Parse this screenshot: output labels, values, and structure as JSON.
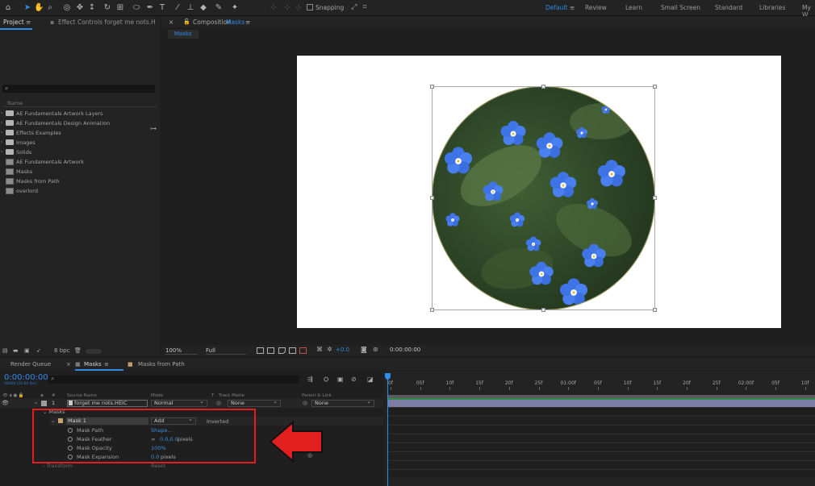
{
  "toolbar": {
    "tools": [
      "selection-tool",
      "hand-tool",
      "zoom-tool",
      "orbit-tool",
      "pan-tool",
      "dolly-tool",
      "rotate-tool",
      "anchor-tool",
      "ellipse-tool",
      "pen-tool",
      "type-tool",
      "brush-tool",
      "clone-tool",
      "eraser-tool",
      "roto-tool",
      "puppet-tool"
    ],
    "snapping_label": "Snapping",
    "workspaces": [
      "Default",
      "Review",
      "Learn",
      "Small Screen",
      "Standard",
      "Libraries",
      "My W"
    ],
    "active_workspace": "Default"
  },
  "project_panel": {
    "tab_project": "Project",
    "tab_effect_controls": "Effect Controls forget me nots.H",
    "column_name": "Name",
    "items": [
      {
        "label": "AE Fundamentals Artwork Layers",
        "type": "folder"
      },
      {
        "label": "AE Fundamentals Design Animation",
        "type": "folder"
      },
      {
        "label": "Effects Examples",
        "type": "folder"
      },
      {
        "label": "Images",
        "type": "folder"
      },
      {
        "label": "Solids",
        "type": "folder"
      },
      {
        "label": "AE Fundamentals Artwork",
        "type": "comp"
      },
      {
        "label": "Masks",
        "type": "comp"
      },
      {
        "label": "Masks from Path",
        "type": "comp"
      },
      {
        "label": "overlord",
        "type": "comp"
      }
    ],
    "bpc": "8 bpc"
  },
  "composition_panel": {
    "title_prefix": "Composition",
    "title_name": "Masks",
    "sub_tab": "Masks",
    "zoom": "100%",
    "resolution": "Full",
    "exposure": "+0.0",
    "timecode": "0:00:00:00"
  },
  "timeline": {
    "tabs": {
      "render_queue": "Render Queue",
      "masks": "Masks",
      "masks_from_path": "Masks from Path"
    },
    "current_time": "0:00:00:00",
    "current_time_sub": "00000 (30.00 fps)",
    "columns": {
      "num": "#",
      "source_name": "Source Name",
      "mode": "Mode",
      "t": "T",
      "track_matte": "Track Matte",
      "parent": "Parent & Link"
    },
    "layer": {
      "number": "1",
      "name": "forget me nots.HEIC",
      "mode": "Normal",
      "track_matte": "None",
      "parent": "None"
    },
    "masks_group": "Masks",
    "mask": {
      "name": "Mask 1",
      "mode": "Add",
      "inverted_label": "Inverted",
      "properties": [
        {
          "name": "Mask Path",
          "value": "Shape..."
        },
        {
          "name": "Mask Feather",
          "value": "0.0,0.0",
          "unit": "pixels"
        },
        {
          "name": "Mask Opacity",
          "value": "100%"
        },
        {
          "name": "Mask Expansion",
          "value": "0.0",
          "unit": "pixels"
        }
      ]
    },
    "transform_label": "Transform",
    "transform_value": "Reset",
    "ruler": [
      "0f",
      "05f",
      "10f",
      "15f",
      "20f",
      "25f",
      "01:00f",
      "05f",
      "10f",
      "15f",
      "20f",
      "25f",
      "02:00f",
      "05f",
      "10f"
    ]
  },
  "colors": {
    "accent": "#2d8ceb",
    "highlight": "#e11f1f",
    "layer_bar": "#7c7ca4"
  }
}
